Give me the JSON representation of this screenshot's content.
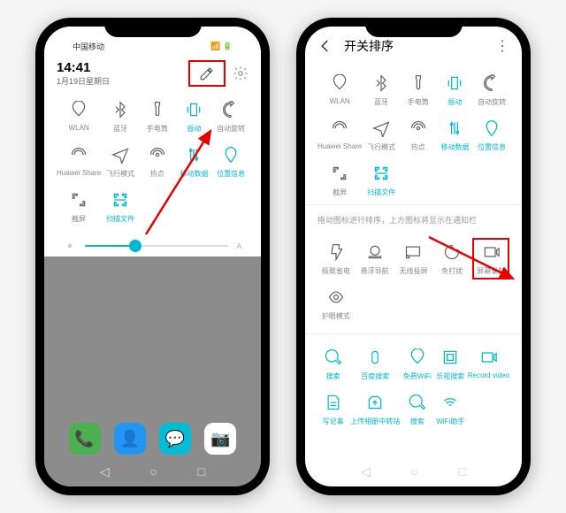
{
  "phone1": {
    "statusbar": {
      "carrier": "中国移动"
    },
    "header": {
      "time": "14:41",
      "date": "1月19日星期日"
    },
    "tiles": [
      {
        "label": "WLAN",
        "active": false
      },
      {
        "label": "蓝牙",
        "active": false
      },
      {
        "label": "手电筒",
        "active": false
      },
      {
        "label": "振动",
        "active": true
      },
      {
        "label": "自动旋转",
        "active": false
      },
      {
        "label": "Huawei Share",
        "active": false
      },
      {
        "label": "飞行模式",
        "active": false
      },
      {
        "label": "热点",
        "active": false
      },
      {
        "label": "移动数据",
        "active": true
      },
      {
        "label": "位置信息",
        "active": true
      },
      {
        "label": "截屏",
        "active": false
      },
      {
        "label": "扫描文件",
        "active": true
      }
    ]
  },
  "phone2": {
    "header": {
      "title": "开关排序"
    },
    "tiles_top": [
      {
        "label": "WLAN"
      },
      {
        "label": "蓝牙"
      },
      {
        "label": "手电筒"
      },
      {
        "label": "振动",
        "active": true
      },
      {
        "label": "自动旋转"
      },
      {
        "label": "Huawei Share"
      },
      {
        "label": "飞行模式"
      },
      {
        "label": "热点"
      },
      {
        "label": "移动数据",
        "active": true
      },
      {
        "label": "位置信息",
        "active": true
      },
      {
        "label": "截屏"
      },
      {
        "label": "扫描文件",
        "active": true
      }
    ],
    "divider_text": "拖动图标进行排序，上方图标将显示在通知栏",
    "tiles_mid": [
      {
        "label": "极致省电"
      },
      {
        "label": "悬浮导航"
      },
      {
        "label": "无线投屏"
      },
      {
        "label": "免打扰"
      },
      {
        "label": "屏幕录制",
        "highlight": true
      },
      {
        "label": "护眼模式"
      }
    ],
    "tiles_bottom": [
      {
        "label": "搜索",
        "active": true
      },
      {
        "label": "百度搜索",
        "active": true
      },
      {
        "label": "免费WiFi",
        "active": true
      },
      {
        "label": "乐视搜索",
        "active": true
      },
      {
        "label": "Record video",
        "active": true
      },
      {
        "label": "写记事",
        "active": true
      },
      {
        "label": "上传相册中转站",
        "active": true
      },
      {
        "label": "搜索",
        "active": true
      },
      {
        "label": "WiFi助手",
        "active": true
      }
    ]
  }
}
